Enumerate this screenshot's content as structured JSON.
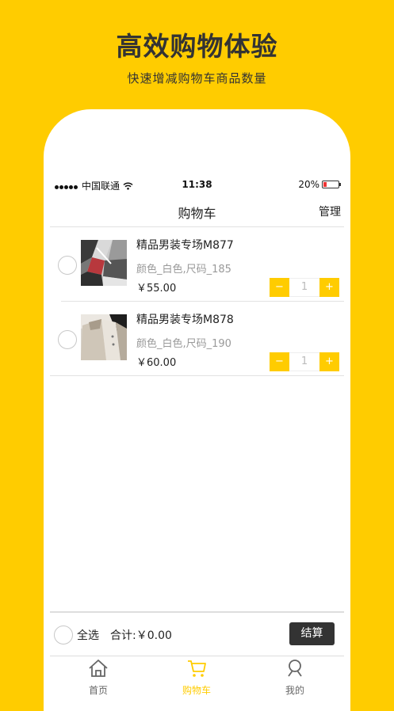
{
  "promo": {
    "title": "高效购物体验",
    "subtitle": "快速增减购物车商品数量"
  },
  "status_bar": {
    "carrier": "中国联通",
    "time": "11:38",
    "battery": "20%"
  },
  "navbar": {
    "title": "购物车",
    "manage": "管理"
  },
  "cart_items": [
    {
      "name": "精品男装专场M877",
      "spec": "颜色_白色,尺码_185",
      "price": "￥55.00",
      "qty": "1"
    },
    {
      "name": "精品男装专场M878",
      "spec": "颜色_白色,尺码_190",
      "price": "￥60.00",
      "qty": "1"
    }
  ],
  "stepper": {
    "minus": "−",
    "plus": "+"
  },
  "checkout": {
    "select_all": "全选",
    "total": "合计:￥0.00",
    "pay": "结算"
  },
  "tabs": [
    {
      "label": "首页",
      "icon": "home-icon"
    },
    {
      "label": "购物车",
      "icon": "cart-icon",
      "active": true
    },
    {
      "label": "我的",
      "icon": "profile-icon"
    }
  ],
  "colors": {
    "accent": "#ffcc00",
    "dark": "#333333",
    "tab_inactive": "#666666"
  }
}
